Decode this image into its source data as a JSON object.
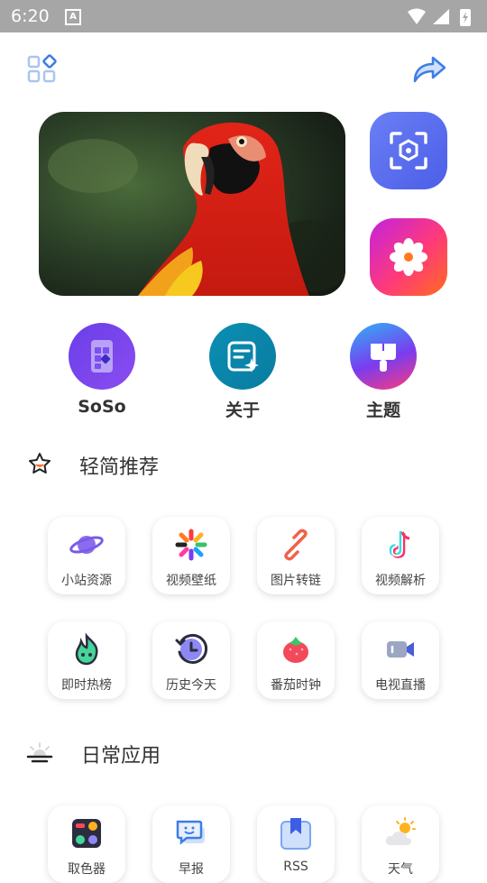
{
  "status_bar": {
    "time": "6:20",
    "notification_icon": "A"
  },
  "header": {
    "grid_icon": "apps-grid-icon",
    "share_icon": "share-arrow-icon"
  },
  "hero": {
    "image": "scarlet-macaw-parrot"
  },
  "side_buttons": [
    {
      "name": "scan",
      "icon": "scan-icon",
      "color": "#5b6df0"
    },
    {
      "name": "flower",
      "icon": "flower-icon",
      "color": "#e0359b"
    }
  ],
  "round_apps": [
    {
      "label": "SoSo"
    },
    {
      "label": "关于"
    },
    {
      "label": "主题"
    }
  ],
  "section1": {
    "title": "轻简推荐"
  },
  "grid1": [
    {
      "label": "小站资源",
      "icon": "planet-icon"
    },
    {
      "label": "视频壁纸",
      "icon": "pinwheel-icon"
    },
    {
      "label": "图片转链",
      "icon": "link-icon"
    },
    {
      "label": "视频解析",
      "icon": "tiktok-icon"
    },
    {
      "label": "即时热榜",
      "icon": "flame-icon"
    },
    {
      "label": "历史今天",
      "icon": "clock-history-icon"
    },
    {
      "label": "番茄时钟",
      "icon": "tomato-icon"
    },
    {
      "label": "电视直播",
      "icon": "video-camera-icon"
    }
  ],
  "section2": {
    "title": "日常应用"
  },
  "grid2": [
    {
      "label": "取色器",
      "icon": "palette-icon"
    },
    {
      "label": "早报",
      "icon": "chat-bubble-icon"
    },
    {
      "label": "RSS",
      "icon": "bookmark-icon"
    },
    {
      "label": "天气",
      "icon": "weather-icon"
    }
  ]
}
